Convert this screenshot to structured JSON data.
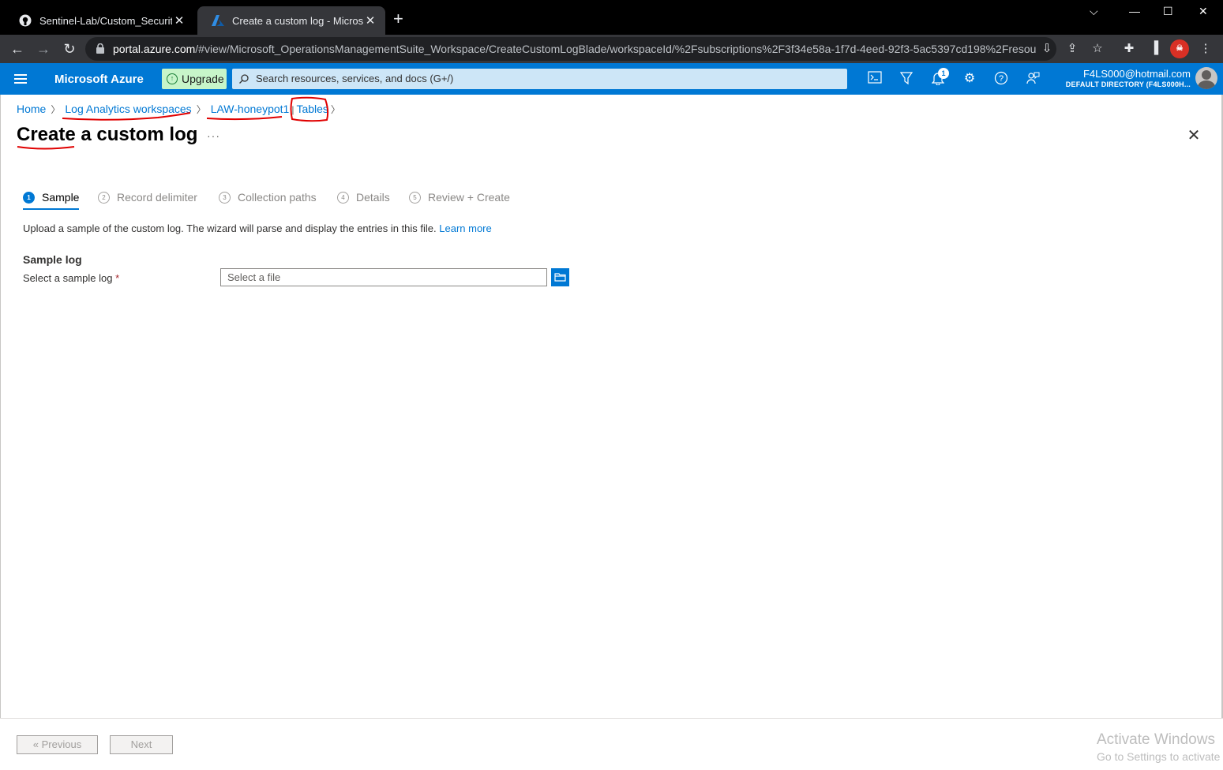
{
  "browser": {
    "tabs": [
      {
        "title": "Sentinel-Lab/Custom_Security_Lo",
        "favicon": "github-icon",
        "active": false
      },
      {
        "title": "Create a custom log - Microsoft",
        "favicon": "azure-icon",
        "active": true
      }
    ],
    "new_tab": "+",
    "url_host": "portal.azure.com",
    "url_path": "/#view/Microsoft_OperationsManagementSuite_Workspace/CreateCustomLogBlade/workspaceId/%2Fsubscriptions%2F3f34e58a-1f7d-4eed-92f3-5ac5397cd198%2Fresou..."
  },
  "header": {
    "brand": "Microsoft Azure",
    "upgrade_label": "Upgrade",
    "search_placeholder": "Search resources, services, and docs (G+/)",
    "notification_count": "1",
    "account_email": "F4LS000@hotmail.com",
    "account_directory": "DEFAULT DIRECTORY (F4LS000H..."
  },
  "breadcrumb": [
    "Home",
    "Log Analytics workspaces",
    "LAW-honeypot1",
    "Tables"
  ],
  "page": {
    "title": "Create a custom log",
    "more": "···"
  },
  "wizard": [
    {
      "num": "1",
      "label": "Sample",
      "active": true
    },
    {
      "num": "2",
      "label": "Record delimiter",
      "active": false
    },
    {
      "num": "3",
      "label": "Collection paths",
      "active": false
    },
    {
      "num": "4",
      "label": "Details",
      "active": false
    },
    {
      "num": "5",
      "label": "Review + Create",
      "active": false
    }
  ],
  "content": {
    "description": "Upload a sample of the custom log. The wizard will parse and display the entries in this file.",
    "learn_more": "Learn more",
    "section_title": "Sample log",
    "field_label": "Select a sample log",
    "required_mark": "*",
    "file_placeholder": "Select a file"
  },
  "footer": {
    "previous": "« Previous",
    "next": "Next"
  },
  "watermark": {
    "line1": "Activate Windows",
    "line2": "Go to Settings to activate Windows."
  },
  "colors": {
    "azure_blue": "#0078d4",
    "annotation_red": "#e00000",
    "upgrade_green": "#c7f5c9"
  }
}
